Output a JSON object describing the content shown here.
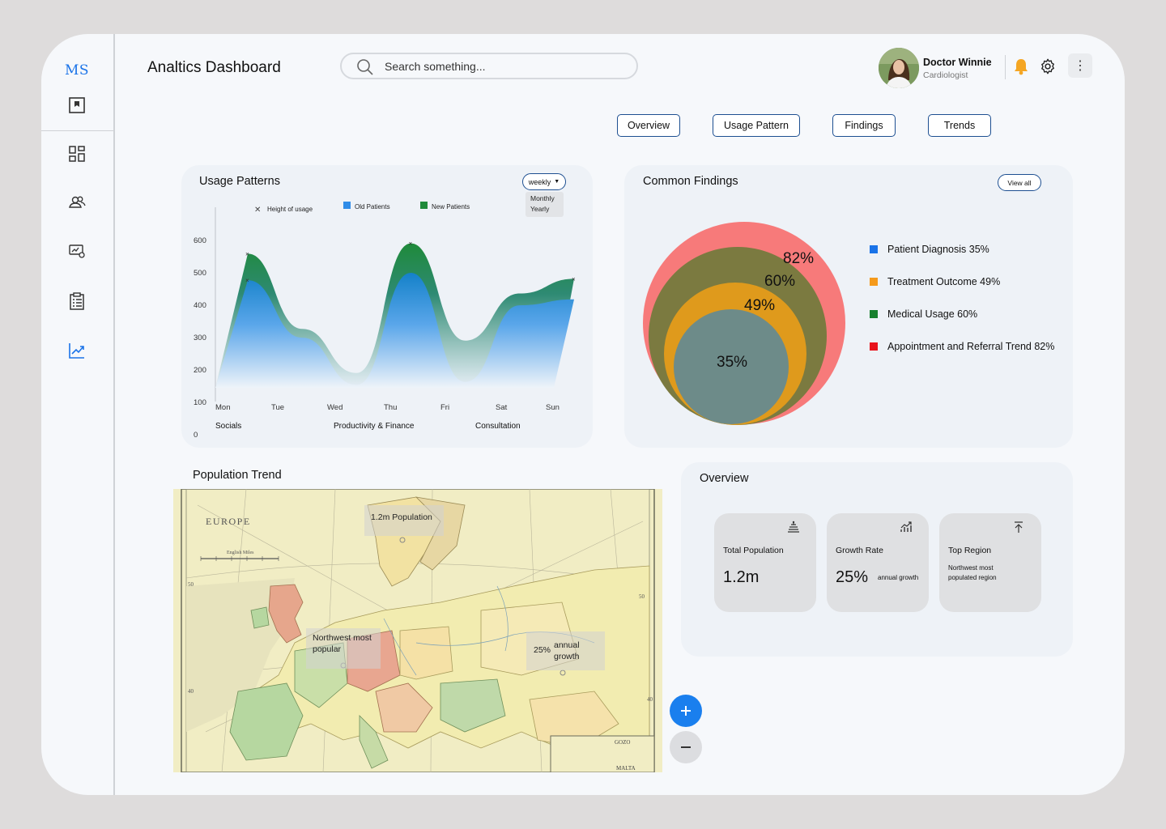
{
  "app": {
    "logo": "MS",
    "title": "Analtics Dashboard"
  },
  "search": {
    "placeholder": "Search something..."
  },
  "user": {
    "name": "Doctor Winnie",
    "role": "Cardiologist"
  },
  "header_icons": [
    "bell-icon",
    "gear-icon",
    "more-vertical-icon"
  ],
  "sidebar": {
    "items": [
      "image-icon",
      "grid-icon",
      "users-icon",
      "monitor-settings-icon",
      "clipboard-list-icon",
      "trend-chart-icon"
    ],
    "active": "trend-chart-icon"
  },
  "tabs": [
    "Overview",
    "Usage Pattern",
    "Findings",
    "Trends"
  ],
  "usage": {
    "title": "Usage Patterns",
    "dropdown": {
      "selected": "weekly",
      "options": [
        "Monthly",
        "Yearly"
      ]
    },
    "legend": [
      "Height of usage",
      "Old Patients",
      "New Patients"
    ],
    "colors": {
      "old": "#2f8ce8",
      "new": "#1f8a3a"
    },
    "y_ticks": [
      "600",
      "500",
      "400",
      "300",
      "200",
      "100",
      "0"
    ],
    "x_ticks": [
      "Mon",
      "Tue",
      "Wed",
      "Thu",
      "Fri",
      "Sat",
      "Sun"
    ],
    "groups": [
      "Socials",
      "Productivity & Finance",
      "Consultation"
    ]
  },
  "chart_data": {
    "type": "area",
    "categories": [
      "Mon",
      "Tue",
      "Wed",
      "Thu",
      "Fri",
      "Sat",
      "Sun"
    ],
    "series": [
      {
        "name": "New Patients",
        "values": [
          555,
          300,
          150,
          590,
          260,
          420,
          470
        ]
      },
      {
        "name": "Old Patients",
        "values": [
          465,
          270,
          110,
          490,
          120,
          380,
          400
        ]
      }
    ],
    "ylim": [
      0,
      600
    ],
    "y_ticks": [
      100,
      200,
      300,
      400,
      500,
      600,
      0
    ]
  },
  "findings": {
    "title": "Common Findings",
    "view_all": "View all",
    "circles": [
      {
        "label": "82%",
        "color": "#f77a7a"
      },
      {
        "label": "60%",
        "color": "#7b7a40"
      },
      {
        "label": "49%",
        "color": "#df9a1c"
      },
      {
        "label": "35%",
        "color": "#6d8b89"
      }
    ],
    "legend": [
      {
        "label": "Patient Diagnosis 35%",
        "color": "#1a73e8"
      },
      {
        "label": "Treatment Outcome 49%",
        "color": "#f59a1b"
      },
      {
        "label": "Medical Usage 60%",
        "color": "#17802e"
      },
      {
        "label": "Appointment and Referral Trend 82%",
        "color": "#e8141c"
      }
    ]
  },
  "population": {
    "title": "Population Trend",
    "map_title": "EUROPE",
    "scale_label": "English Miles",
    "labels": {
      "population": "1.2m  Population",
      "region": "Northwest most popular",
      "growth_pct": "25%",
      "growth_text": "annual growth"
    }
  },
  "overview": {
    "title": "Overview",
    "stats": [
      {
        "label": "Total Population",
        "value": "1.2m",
        "sub": ""
      },
      {
        "label": "Growth Rate",
        "value": "25%",
        "sub": "annual growth"
      },
      {
        "label": "Top Region",
        "value": "",
        "sub": "Northwest most populated region"
      }
    ]
  }
}
